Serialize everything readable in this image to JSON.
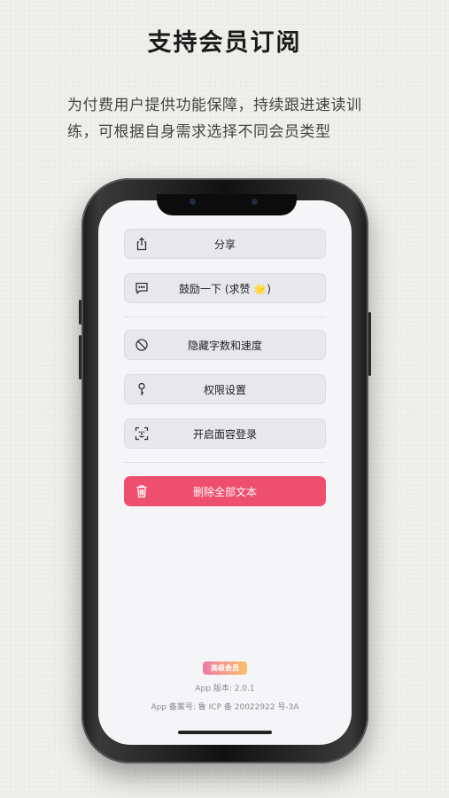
{
  "promo": {
    "headline": "支持会员订阅",
    "subline1": "为付费用户提供功能保障，持续跟进速读训",
    "subline2": "练，可根据自身需求选择不同会员类型"
  },
  "menu": {
    "share": {
      "label": "分享",
      "icon": "share-icon"
    },
    "encourage": {
      "label": "鼓励一下 (求赞 🌟)",
      "icon": "chat-bubble-icon"
    },
    "hide_stats": {
      "label": "隐藏字数和速度",
      "icon": "hidden-circle-icon"
    },
    "permissions": {
      "label": "权限设置",
      "icon": "key-icon"
    },
    "face_login": {
      "label": "开启面容登录",
      "icon": "face-id-icon"
    },
    "delete_all": {
      "label": "删除全部文本",
      "icon": "trash-icon"
    }
  },
  "footer": {
    "badge": "高级会员",
    "version": "App 版本: 2.0.1",
    "icp": "App 备案号: 鲁 ICP 备 20022922 号-3A"
  },
  "colors": {
    "danger": "#ee4f6f",
    "button_bg": "#e8e8ec",
    "screen_bg": "#f5f5f7"
  }
}
